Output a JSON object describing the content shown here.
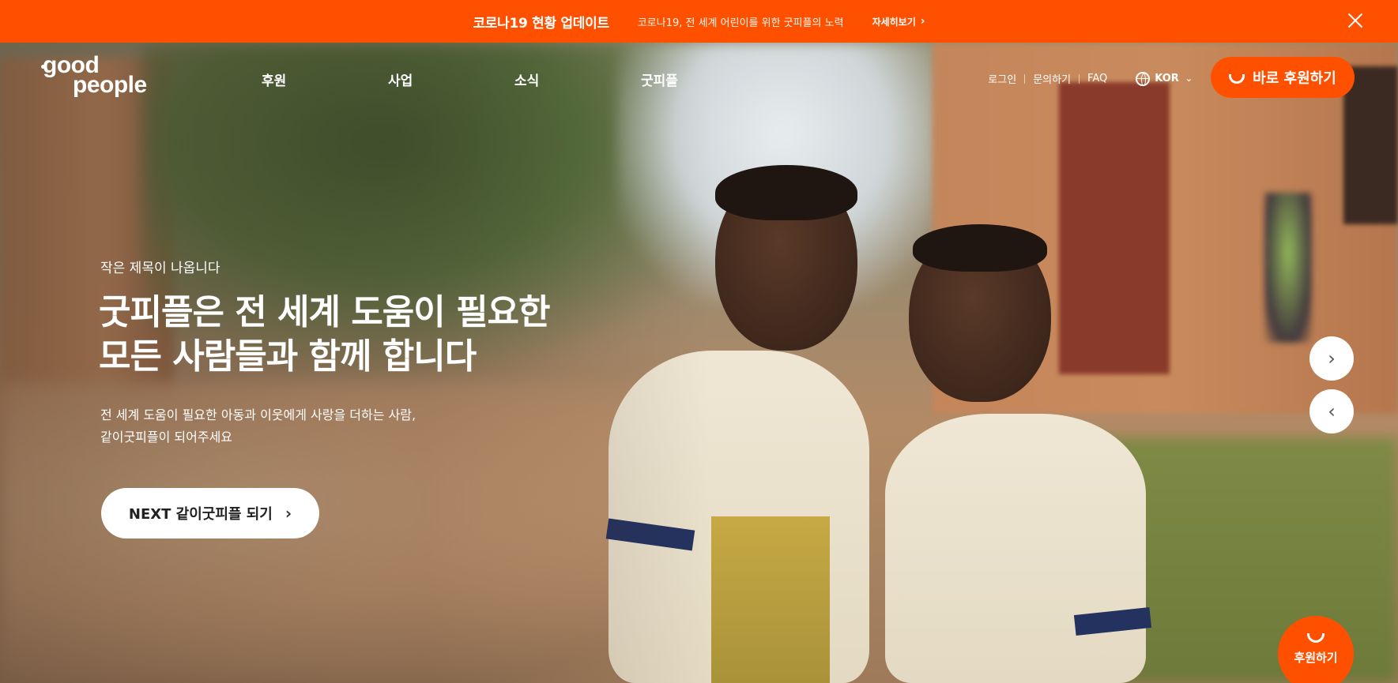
{
  "banner": {
    "title": "코로나19 현황 업데이트",
    "description": "코로나19, 전 세계 어린이를 위한 굿피플의 노력",
    "link_label": "자세히보기",
    "background": "#ff5000"
  },
  "logo": {
    "line1": "good",
    "line2": "people"
  },
  "nav": {
    "items": [
      {
        "label": "후원"
      },
      {
        "label": "사업"
      },
      {
        "label": "소식"
      },
      {
        "label": "굿피플"
      }
    ]
  },
  "utility": {
    "login": "로그인",
    "inquiry": "문의하기",
    "faq": "FAQ",
    "language": "KOR"
  },
  "donate_button": {
    "label": "바로 후원하기",
    "icon": "smile-icon"
  },
  "hero": {
    "subtitle": "작은 제목이 나옵니다",
    "title_line1": "굿피플은 전 세계 도움이 필요한",
    "title_line2": "모든 사람들과 함께 합니다",
    "desc_line1": "전 세계 도움이 필요한 아동과 이웃에게 사랑을 더하는 사람,",
    "desc_line2": "같이굿피플이 되어주세요",
    "cta_label": "NEXT 같이굿피플 되기"
  },
  "slider": {
    "next_icon": "chevron-right-icon",
    "prev_icon": "chevron-left-icon"
  },
  "floating_donate": {
    "label": "후원하기",
    "icon": "smile-icon"
  },
  "colors": {
    "brand": "#ff5000",
    "text_on_dark": "#ffffff"
  }
}
